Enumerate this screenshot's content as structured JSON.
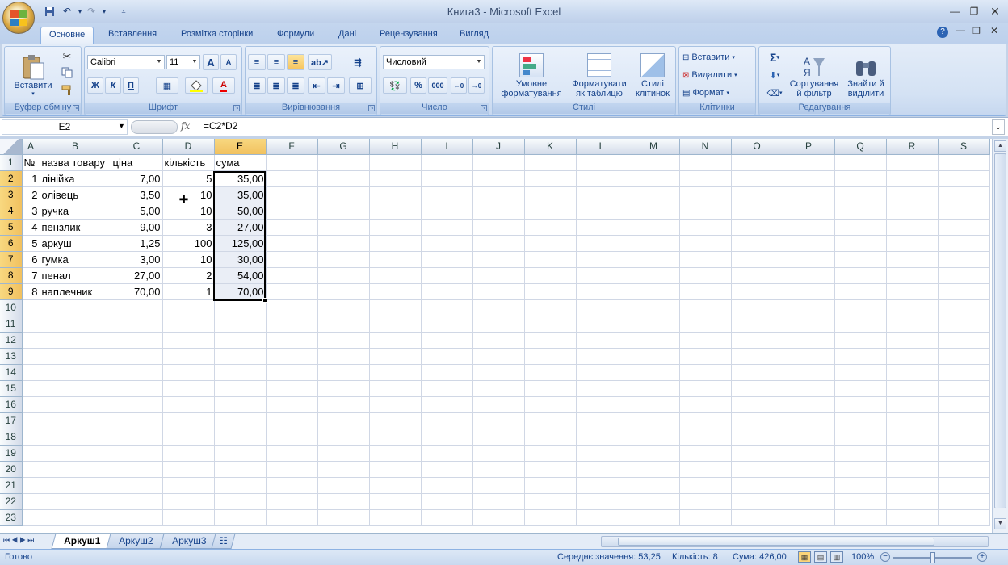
{
  "window": {
    "title": "Книга3 - Microsoft Excel"
  },
  "ribbon": {
    "tabs": [
      "Основне",
      "Вставлення",
      "Розмітка сторінки",
      "Формули",
      "Дані",
      "Рецензування",
      "Вигляд"
    ],
    "clipboard": {
      "label": "Буфер обміну",
      "paste": "Вставити"
    },
    "font": {
      "label": "Шрифт",
      "name": "Calibri",
      "size": "11",
      "bold": "Ж",
      "italic": "К",
      "underline": "П",
      "grow": "A",
      "shrink": "A",
      "color_letter": "A"
    },
    "alignment": {
      "label": "Вирівнювання"
    },
    "number": {
      "label": "Число",
      "format": "Числовий",
      "percent": "%",
      "thousands": "000"
    },
    "styles": {
      "label": "Стилі",
      "conditional": [
        "Умовне",
        "форматування"
      ],
      "as_table": [
        "Форматувати",
        "як таблицю"
      ],
      "cell_styles": [
        "Стилі",
        "клітинок"
      ]
    },
    "cells": {
      "label": "Клітинки",
      "insert": "Вставити",
      "delete": "Видалити",
      "format": "Формат"
    },
    "editing": {
      "label": "Редагування",
      "sigma": "Σ",
      "sort": [
        "Сортування",
        "й фільтр"
      ],
      "find": [
        "Знайти й",
        "виділити"
      ]
    }
  },
  "formula_bar": {
    "name_box": "E2",
    "fx": "fx",
    "formula": "=C2*D2"
  },
  "sheet": {
    "columns": [
      "A",
      "B",
      "C",
      "D",
      "E",
      "F",
      "G",
      "H",
      "I",
      "J",
      "K",
      "L",
      "M",
      "N",
      "O",
      "P",
      "Q",
      "R",
      "S"
    ],
    "selected_column": "E",
    "selected_rows": [
      2,
      3,
      4,
      5,
      6,
      7,
      8,
      9
    ],
    "row_count": 23,
    "rows": [
      [
        "№",
        "назва товару",
        "ціна",
        "кількість",
        "сума"
      ],
      [
        "1",
        "лінійка",
        "7,00",
        "5",
        "35,00"
      ],
      [
        "2",
        "олівець",
        "3,50",
        "10",
        "35,00"
      ],
      [
        "3",
        "ручка",
        "5,00",
        "10",
        "50,00"
      ],
      [
        "4",
        "пензлик",
        "9,00",
        "3",
        "27,00"
      ],
      [
        "5",
        "аркуш",
        "1,25",
        "100",
        "125,00"
      ],
      [
        "6",
        "гумка",
        "3,00",
        "10",
        "30,00"
      ],
      [
        "7",
        "пенал",
        "27,00",
        "2",
        "54,00"
      ],
      [
        "8",
        "наплечник",
        "70,00",
        "1",
        "70,00"
      ]
    ]
  },
  "sheet_tabs": [
    "Аркуш1",
    "Аркуш2",
    "Аркуш3"
  ],
  "active_sheet": "Аркуш1",
  "status": {
    "ready": "Готово",
    "average": "Середнє значення: 53,25",
    "count": "Кількість: 8",
    "sum": "Сума: 426,00",
    "zoom": "100%"
  }
}
